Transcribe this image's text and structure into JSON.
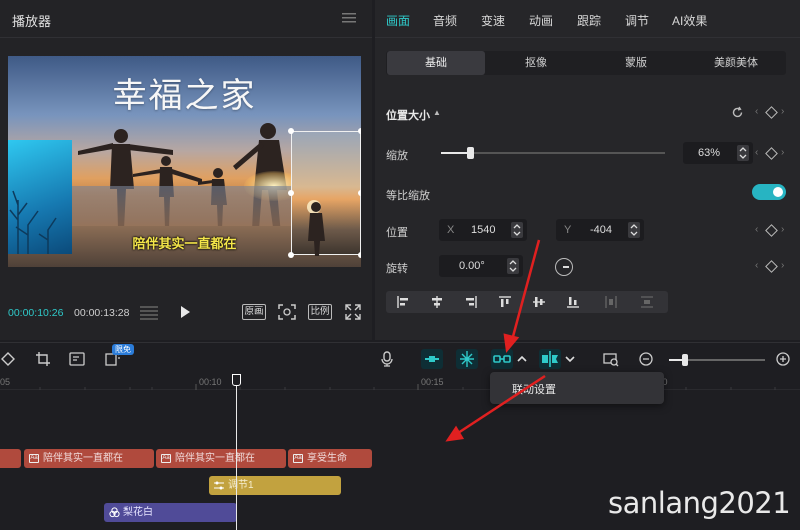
{
  "player": {
    "title": "播放器",
    "video_title": "幸福之家",
    "video_subtitle": "陪伴其实一直都在",
    "time_current": "00:00:10:26",
    "time_total": "00:00:13:28",
    "original_label": "原画",
    "ratio_label": "比例"
  },
  "properties": {
    "tabs": [
      "画面",
      "音频",
      "变速",
      "动画",
      "跟踪",
      "调节",
      "AI效果"
    ],
    "active_tab": "画面",
    "subtabs": [
      "基础",
      "抠像",
      "蒙版",
      "美颜美体"
    ],
    "active_subtab": "基础",
    "section_title": "位置大小",
    "scale_label": "缩放",
    "scale_value": "63%",
    "scale_fraction": 0.63,
    "uniform_scale_label": "等比缩放",
    "uniform_scale_on": true,
    "position_label": "位置",
    "x_label": "X",
    "x_value": "1540",
    "y_label": "Y",
    "y_value": "-404",
    "rotation_label": "旋转",
    "rotation_value": "0.00°"
  },
  "toolbar": {
    "free_badge": "限免",
    "zoom_level": 0.17
  },
  "timeline": {
    "ruler": [
      "05",
      "00:10",
      "00:15",
      "00:20"
    ],
    "text_clips": [
      "陪伴其实一直都在",
      "陪伴其实一直都在",
      "享受生命"
    ],
    "adjust_clip": "调节1",
    "effect_clip": "梨花白"
  },
  "dropdown": {
    "item": "联动设置"
  },
  "watermark": "sanlang2021",
  "colors": {
    "accent": "#2fc9c9",
    "text_clip": "#b04a3d",
    "adjust_clip": "#c2a23f",
    "effect_clip": "#504b98",
    "annotation_arrow": "#e02020"
  }
}
